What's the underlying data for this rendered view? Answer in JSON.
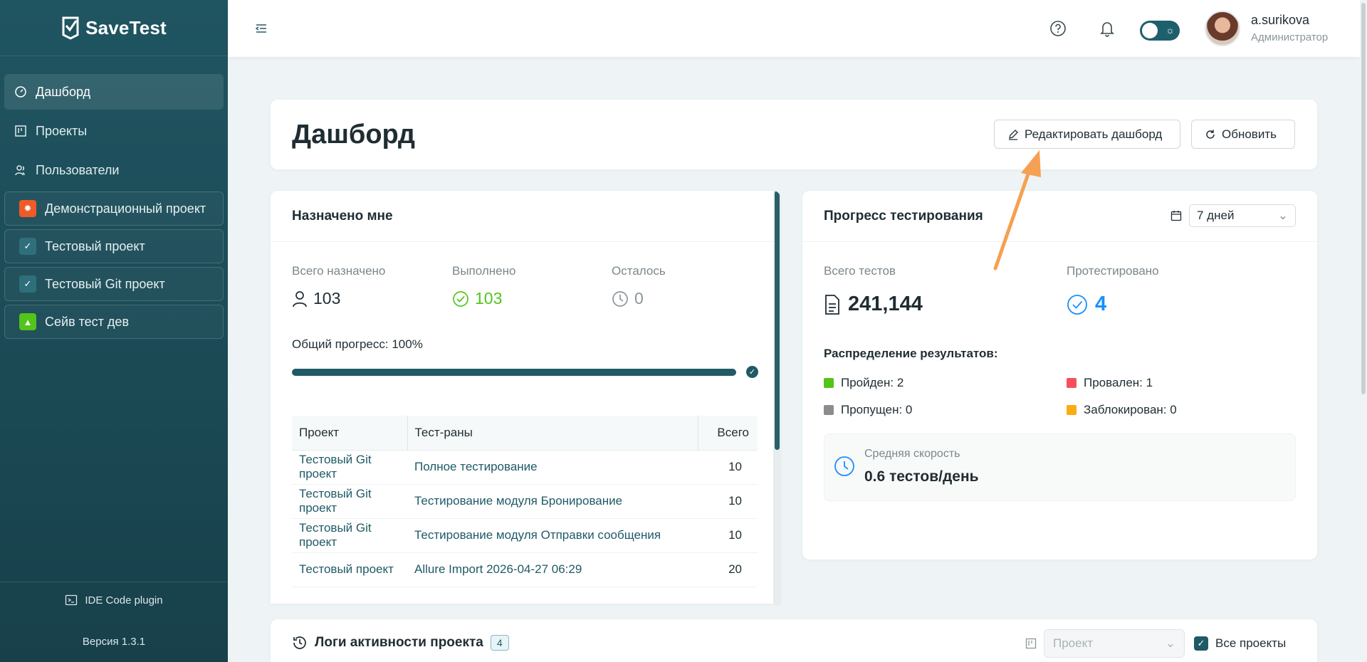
{
  "app": {
    "logo_text": "SaveTest"
  },
  "sidebar": {
    "nav": [
      {
        "label": "Дашборд",
        "icon": "dashboard-icon",
        "active": true
      },
      {
        "label": "Проекты",
        "icon": "board-icon"
      },
      {
        "label": "Пользователи",
        "icon": "users-icon"
      }
    ],
    "projects": [
      {
        "label": "Демонстрационный проект",
        "color": "#f05a28",
        "icon": "bug-icon"
      },
      {
        "label": "Тестовый проект",
        "color": "#2e6f7c",
        "icon": "checklist-icon"
      },
      {
        "label": "Тестовый Git проект",
        "color": "#2e6f7c",
        "icon": "checklist-icon"
      },
      {
        "label": "Сейв тест дев",
        "color": "#52c41a",
        "icon": "rocket-icon"
      }
    ],
    "ide_plugin": "IDE Code plugin",
    "version": "Версия 1.3.1"
  },
  "header": {
    "user_name": "a.surikova",
    "user_role": "Администратор"
  },
  "page": {
    "title": "Дашборд",
    "edit_button": "Редактировать дашборд",
    "refresh_button": "Обновить"
  },
  "assigned": {
    "title": "Назначено мне",
    "total_label": "Всего назначено",
    "total_value": "103",
    "done_label": "Выполнено",
    "done_value": "103",
    "left_label": "Осталось",
    "left_value": "0",
    "progress_label": "Общий прогресс: 100%",
    "progress_fraction": 1.0,
    "table": {
      "headers": [
        "Проект",
        "Тест-раны",
        "Всего"
      ],
      "rows": [
        [
          "Тестовый Git проект",
          "Полное тестирование",
          "10"
        ],
        [
          "Тестовый Git проект",
          "Тестирование модуля Бронирование",
          "10"
        ],
        [
          "Тестовый Git проект",
          "Тестирование модуля Отправки сообщения",
          "10"
        ],
        [
          "Тестовый проект",
          "Allure Import 2026-04-27 06:29",
          "20"
        ]
      ]
    }
  },
  "testing_progress": {
    "title": "Прогресс тестирования",
    "period": "7 дней",
    "total_tests_label": "Всего тестов",
    "total_tests_value": "241,144",
    "tested_label": "Протестировано",
    "tested_value": "4",
    "distribution_title": "Распределение результатов:",
    "distribution": [
      {
        "label": "Пройден: 2",
        "color": "#52c41a"
      },
      {
        "label": "Провален: 1",
        "color": "#f5505a"
      },
      {
        "label": "Пропущен: 0",
        "color": "#8c8c8c"
      },
      {
        "label": "Заблокирован: 0",
        "color": "#faad14"
      }
    ],
    "speed_label": "Средняя скорость",
    "speed_value": "0.6 тестов/день"
  },
  "logs": {
    "title": "Логи активности проекта",
    "count": "4",
    "project_placeholder": "Проект",
    "all_projects_label": "Все проекты"
  },
  "colors": {
    "primary": "#1f5a66",
    "accent_arrow": "#f5a052",
    "blue": "#1890ff",
    "green": "#52c41a"
  }
}
